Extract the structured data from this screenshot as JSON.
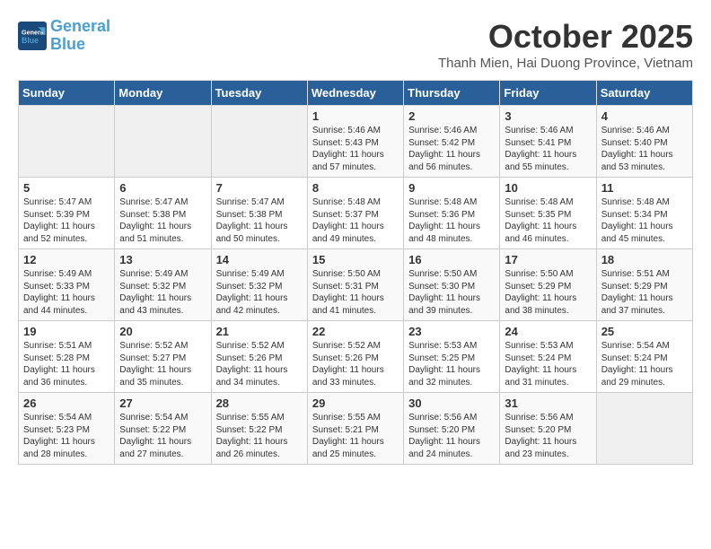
{
  "header": {
    "logo_line1": "General",
    "logo_line2": "Blue",
    "month": "October 2025",
    "location": "Thanh Mien, Hai Duong Province, Vietnam"
  },
  "weekdays": [
    "Sunday",
    "Monday",
    "Tuesday",
    "Wednesday",
    "Thursday",
    "Friday",
    "Saturday"
  ],
  "weeks": [
    [
      {
        "day": "",
        "info": ""
      },
      {
        "day": "",
        "info": ""
      },
      {
        "day": "",
        "info": ""
      },
      {
        "day": "1",
        "info": "Sunrise: 5:46 AM\nSunset: 5:43 PM\nDaylight: 11 hours\nand 57 minutes."
      },
      {
        "day": "2",
        "info": "Sunrise: 5:46 AM\nSunset: 5:42 PM\nDaylight: 11 hours\nand 56 minutes."
      },
      {
        "day": "3",
        "info": "Sunrise: 5:46 AM\nSunset: 5:41 PM\nDaylight: 11 hours\nand 55 minutes."
      },
      {
        "day": "4",
        "info": "Sunrise: 5:46 AM\nSunset: 5:40 PM\nDaylight: 11 hours\nand 53 minutes."
      }
    ],
    [
      {
        "day": "5",
        "info": "Sunrise: 5:47 AM\nSunset: 5:39 PM\nDaylight: 11 hours\nand 52 minutes."
      },
      {
        "day": "6",
        "info": "Sunrise: 5:47 AM\nSunset: 5:38 PM\nDaylight: 11 hours\nand 51 minutes."
      },
      {
        "day": "7",
        "info": "Sunrise: 5:47 AM\nSunset: 5:38 PM\nDaylight: 11 hours\nand 50 minutes."
      },
      {
        "day": "8",
        "info": "Sunrise: 5:48 AM\nSunset: 5:37 PM\nDaylight: 11 hours\nand 49 minutes."
      },
      {
        "day": "9",
        "info": "Sunrise: 5:48 AM\nSunset: 5:36 PM\nDaylight: 11 hours\nand 48 minutes."
      },
      {
        "day": "10",
        "info": "Sunrise: 5:48 AM\nSunset: 5:35 PM\nDaylight: 11 hours\nand 46 minutes."
      },
      {
        "day": "11",
        "info": "Sunrise: 5:48 AM\nSunset: 5:34 PM\nDaylight: 11 hours\nand 45 minutes."
      }
    ],
    [
      {
        "day": "12",
        "info": "Sunrise: 5:49 AM\nSunset: 5:33 PM\nDaylight: 11 hours\nand 44 minutes."
      },
      {
        "day": "13",
        "info": "Sunrise: 5:49 AM\nSunset: 5:32 PM\nDaylight: 11 hours\nand 43 minutes."
      },
      {
        "day": "14",
        "info": "Sunrise: 5:49 AM\nSunset: 5:32 PM\nDaylight: 11 hours\nand 42 minutes."
      },
      {
        "day": "15",
        "info": "Sunrise: 5:50 AM\nSunset: 5:31 PM\nDaylight: 11 hours\nand 41 minutes."
      },
      {
        "day": "16",
        "info": "Sunrise: 5:50 AM\nSunset: 5:30 PM\nDaylight: 11 hours\nand 39 minutes."
      },
      {
        "day": "17",
        "info": "Sunrise: 5:50 AM\nSunset: 5:29 PM\nDaylight: 11 hours\nand 38 minutes."
      },
      {
        "day": "18",
        "info": "Sunrise: 5:51 AM\nSunset: 5:29 PM\nDaylight: 11 hours\nand 37 minutes."
      }
    ],
    [
      {
        "day": "19",
        "info": "Sunrise: 5:51 AM\nSunset: 5:28 PM\nDaylight: 11 hours\nand 36 minutes."
      },
      {
        "day": "20",
        "info": "Sunrise: 5:52 AM\nSunset: 5:27 PM\nDaylight: 11 hours\nand 35 minutes."
      },
      {
        "day": "21",
        "info": "Sunrise: 5:52 AM\nSunset: 5:26 PM\nDaylight: 11 hours\nand 34 minutes."
      },
      {
        "day": "22",
        "info": "Sunrise: 5:52 AM\nSunset: 5:26 PM\nDaylight: 11 hours\nand 33 minutes."
      },
      {
        "day": "23",
        "info": "Sunrise: 5:53 AM\nSunset: 5:25 PM\nDaylight: 11 hours\nand 32 minutes."
      },
      {
        "day": "24",
        "info": "Sunrise: 5:53 AM\nSunset: 5:24 PM\nDaylight: 11 hours\nand 31 minutes."
      },
      {
        "day": "25",
        "info": "Sunrise: 5:54 AM\nSunset: 5:24 PM\nDaylight: 11 hours\nand 29 minutes."
      }
    ],
    [
      {
        "day": "26",
        "info": "Sunrise: 5:54 AM\nSunset: 5:23 PM\nDaylight: 11 hours\nand 28 minutes."
      },
      {
        "day": "27",
        "info": "Sunrise: 5:54 AM\nSunset: 5:22 PM\nDaylight: 11 hours\nand 27 minutes."
      },
      {
        "day": "28",
        "info": "Sunrise: 5:55 AM\nSunset: 5:22 PM\nDaylight: 11 hours\nand 26 minutes."
      },
      {
        "day": "29",
        "info": "Sunrise: 5:55 AM\nSunset: 5:21 PM\nDaylight: 11 hours\nand 25 minutes."
      },
      {
        "day": "30",
        "info": "Sunrise: 5:56 AM\nSunset: 5:20 PM\nDaylight: 11 hours\nand 24 minutes."
      },
      {
        "day": "31",
        "info": "Sunrise: 5:56 AM\nSunset: 5:20 PM\nDaylight: 11 hours\nand 23 minutes."
      },
      {
        "day": "",
        "info": ""
      }
    ]
  ]
}
